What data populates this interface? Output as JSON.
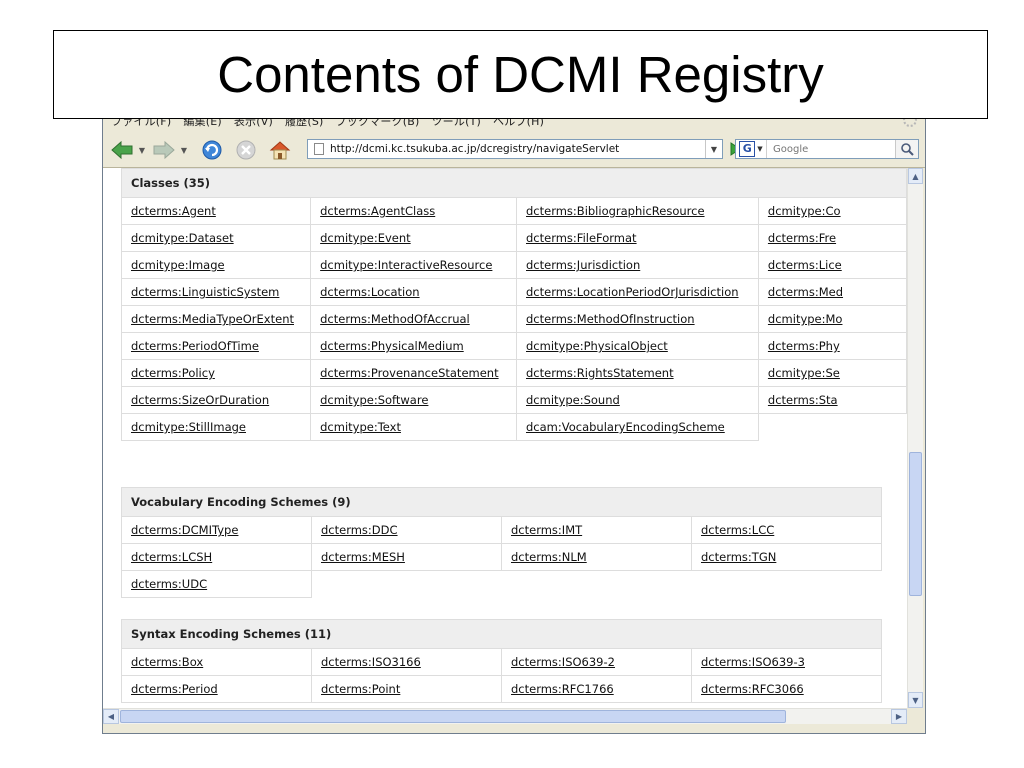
{
  "slide": {
    "title": "Contents of DCMI Registry"
  },
  "browser": {
    "menu_items": [
      "ファイル(F)",
      "編集(E)",
      "表示(V)",
      "履歴(S)",
      "ブックマーク(B)",
      "ツール(T)",
      "ヘルプ(H)"
    ],
    "url": "http://dcmi.kc.tsukuba.ac.jp/dcregistry/navigateServlet",
    "search_placeholder": "Google",
    "search_engine_letter": "G"
  },
  "sections": {
    "classes": {
      "header": "Classes (35)",
      "rows": [
        [
          "dcterms:Agent",
          "dcterms:AgentClass",
          "dcterms:BibliographicResource",
          "dcmitype:Co"
        ],
        [
          "dcmitype:Dataset",
          "dcmitype:Event",
          "dcterms:FileFormat",
          "dcterms:Fre"
        ],
        [
          "dcmitype:Image",
          "dcmitype:InteractiveResource",
          "dcterms:Jurisdiction",
          "dcterms:Lice"
        ],
        [
          "dcterms:LinguisticSystem",
          "dcterms:Location",
          "dcterms:LocationPeriodOrJurisdiction",
          "dcterms:Med"
        ],
        [
          "dcterms:MediaTypeOrExtent",
          "dcterms:MethodOfAccrual",
          "dcterms:MethodOfInstruction",
          "dcmitype:Mo"
        ],
        [
          "dcterms:PeriodOfTime",
          "dcterms:PhysicalMedium",
          "dcmitype:PhysicalObject",
          "dcterms:Phy"
        ],
        [
          "dcterms:Policy",
          "dcterms:ProvenanceStatement",
          "dcterms:RightsStatement",
          "dcmitype:Se"
        ],
        [
          "dcterms:SizeOrDuration",
          "dcmitype:Software",
          "dcmitype:Sound",
          "dcterms:Sta"
        ],
        [
          "dcmitype:StillImage",
          "dcmitype:Text",
          "dcam:VocabularyEncodingScheme",
          ""
        ]
      ]
    },
    "ves": {
      "header": "Vocabulary Encoding Schemes (9)",
      "rows": [
        [
          "dcterms:DCMIType",
          "dcterms:DDC",
          "dcterms:IMT",
          "dcterms:LCC"
        ],
        [
          "dcterms:LCSH",
          "dcterms:MESH",
          "dcterms:NLM",
          "dcterms:TGN"
        ],
        [
          "dcterms:UDC",
          "",
          "",
          ""
        ]
      ]
    },
    "ses": {
      "header": "Syntax Encoding Schemes (11)",
      "rows": [
        [
          "dcterms:Box",
          "dcterms:ISO3166",
          "dcterms:ISO639-2",
          "dcterms:ISO639-3"
        ],
        [
          "dcterms:Period",
          "dcterms:Point",
          "dcterms:RFC1766",
          "dcterms:RFC3066"
        ]
      ]
    }
  }
}
